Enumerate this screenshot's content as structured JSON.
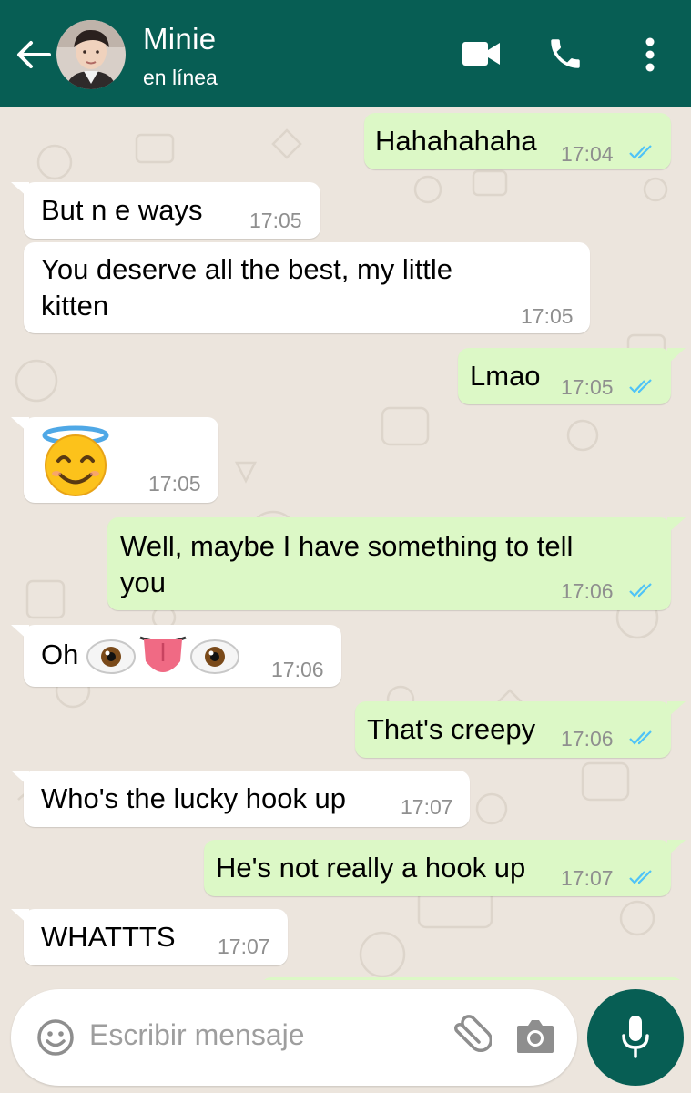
{
  "header": {
    "contact_name": "Minie",
    "contact_status": "en línea"
  },
  "messages": [
    {
      "dir": "out",
      "text": "Hahahahaha",
      "time": "17:04",
      "read": true
    },
    {
      "dir": "in",
      "text": "But n e ways",
      "time": "17:05"
    },
    {
      "dir": "in",
      "text_line1": "You deserve all the best, my little",
      "text_line2": "kitten",
      "time": "17:05"
    },
    {
      "dir": "out",
      "text": "Lmao",
      "time": "17:05",
      "read": true
    },
    {
      "dir": "in",
      "emoji": "smiling-face-with-halo",
      "time": "17:05"
    },
    {
      "dir": "out",
      "text_line1": "Well, maybe I have something to tell",
      "text_line2": "you",
      "time": "17:06",
      "read": true
    },
    {
      "dir": "in",
      "text": "Oh",
      "emojis": [
        "eyes",
        "tongue",
        "eyes"
      ],
      "time": "17:06"
    },
    {
      "dir": "out",
      "text": "That's creepy",
      "time": "17:06",
      "read": true
    },
    {
      "dir": "in",
      "text": "Who's the lucky hook up",
      "time": "17:07"
    },
    {
      "dir": "out",
      "text": "He's not really a hook up",
      "time": "17:07",
      "read": true
    },
    {
      "dir": "in",
      "text": "WHATTTS",
      "time": "17:07"
    }
  ],
  "composer": {
    "placeholder": "Escribir mensaje"
  },
  "icons": {
    "back": "arrow-left-icon",
    "video": "video-camera-icon",
    "call": "phone-icon",
    "menu": "more-vert-icon",
    "emoji": "emoji-icon",
    "attach": "paperclip-icon",
    "camera": "camera-icon",
    "mic": "microphone-icon",
    "read": "double-check-icon"
  },
  "colors": {
    "header": "#075e54",
    "outgoing": "#dcf8c6",
    "incoming": "#ffffff",
    "chat_bg": "#ece5dd",
    "tick_read": "#4fc3f7"
  }
}
